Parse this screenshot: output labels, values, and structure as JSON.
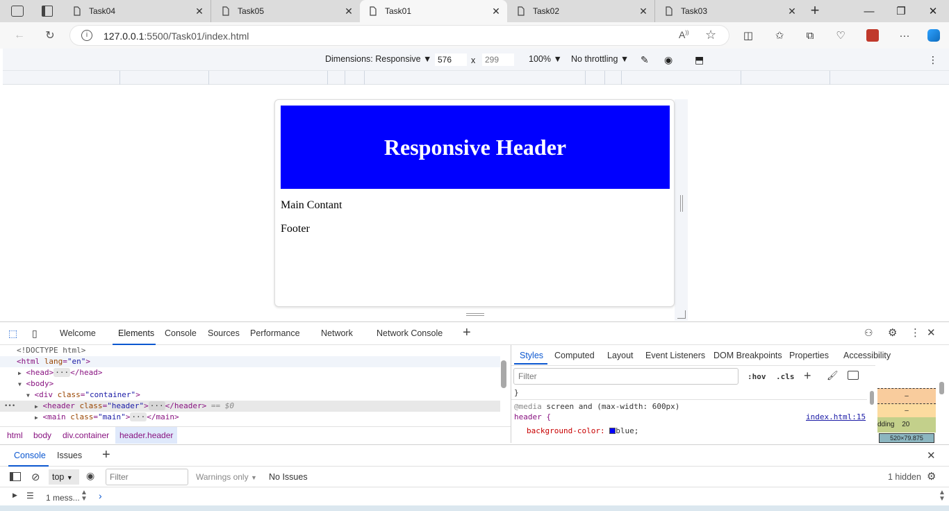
{
  "browser": {
    "tabs": [
      {
        "title": "Task04",
        "active": false
      },
      {
        "title": "Task05",
        "active": false
      },
      {
        "title": "Task01",
        "active": true
      },
      {
        "title": "Task02",
        "active": false
      },
      {
        "title": "Task03",
        "active": false
      }
    ],
    "url_host": "127.0.0.1",
    "url_rest": ":5500/Task01/index.html",
    "profile_color": "#c0392b"
  },
  "device_toolbar": {
    "dimensions_label": "Dimensions: Responsive",
    "width": "576",
    "times": "x",
    "height": "299",
    "zoom": "100%",
    "throttling": "No throttling"
  },
  "page": {
    "header_title": "Responsive Header",
    "header_bg": "#0000ff",
    "main_text": "Main Contant",
    "footer_text": "Footer"
  },
  "devtools": {
    "tabs": [
      "Welcome",
      "Elements",
      "Console",
      "Sources",
      "Performance",
      "Network",
      "Network Console"
    ],
    "active_tab": "Elements",
    "elements": {
      "doctype": "<!DOCTYPE html>",
      "html_open": "<html",
      "html_attr": "lang",
      "html_val": "\"en\"",
      "head": "<head>",
      "head_close": "</head>",
      "body": "<body>",
      "div_open": "<div",
      "class_attr": "class",
      "div_val": "\"container\"",
      "header_open": "<header",
      "header_val": "\"header\"",
      "header_close": "</header>",
      "dollar0": "== $0",
      "main_open": "<main",
      "main_val": "\"main\"",
      "main_close": "</main>",
      "ellipsis": "···",
      "gt": ">",
      "row_dots": "•••"
    },
    "breadcrumbs": [
      "html",
      "body",
      "div.container",
      "header.header"
    ],
    "styles_tabs": [
      "Styles",
      "Computed",
      "Layout",
      "Event Listeners",
      "DOM Breakpoints",
      "Properties",
      "Accessibility"
    ],
    "styles_filter_placeholder": "Filter",
    "hov": ":hov",
    "cls": ".cls",
    "rule_brace": "}",
    "media_keyword": "@media",
    "media_query": "screen and (max-width: 600px)",
    "selector": "header {",
    "source_link": "index.html:15",
    "prop_name": "background-color:",
    "prop_value": "blue;",
    "prop_swatch": "#0000ff",
    "boxmodel": {
      "dash1": "–",
      "dash2": "–",
      "padding_label": "dding",
      "padding_value": "20",
      "content_size": "520×79.875"
    }
  },
  "console_drawer": {
    "tabs": [
      "Console",
      "Issues"
    ],
    "context": "top",
    "filter_placeholder": "Filter",
    "levels": "Warnings only",
    "issues": "No Issues",
    "hidden": "1 hidden",
    "messages": "1 mess..."
  }
}
